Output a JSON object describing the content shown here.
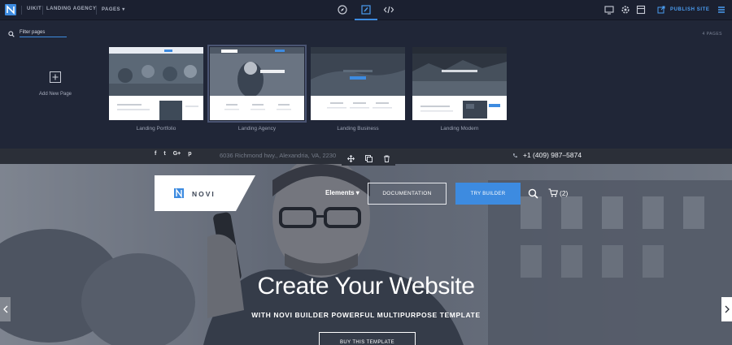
{
  "toolbar": {
    "app_name": "UIKIT",
    "project_name": "LANDING AGENCY",
    "pages_menu": "PAGES",
    "publish_label": "PUBLISH SITE",
    "icons": [
      "compass-icon",
      "edit-icon",
      "code-icon",
      "device-icon",
      "gear-icon",
      "archive-icon",
      "external-link-icon",
      "hamburger-icon"
    ]
  },
  "pages_panel": {
    "filter_label": "Filter pages",
    "pages_count": "4 PAGES",
    "add_page_label": "Add New Page",
    "pages": [
      {
        "label": "Landing Portfolio",
        "active": false
      },
      {
        "label": "Landing Agency",
        "active": true
      },
      {
        "label": "Landing Business",
        "active": false
      },
      {
        "label": "Landing Modern",
        "active": false
      }
    ]
  },
  "preview": {
    "social": [
      "f",
      "t",
      "G+",
      "p"
    ],
    "address": "6036 Richmond hwy., Alexandria, VA, 2230",
    "phone": "+1 (409) 987–5874",
    "nav": {
      "logo_text": "NOVI",
      "elements_menu": "Elements",
      "documentation_button": "DOCUMENTATION",
      "try_button": "TRY BUILDER",
      "cart_count": "(2)"
    },
    "hero": {
      "title": "Create Your Website",
      "subtitle": "WITH NOVI BUILDER POWERFUL MULTIPURPOSE TEMPLATE",
      "button": "BUY THIS TEMPLATE"
    }
  },
  "colors": {
    "accent": "#3d8be0",
    "toolbar_bg": "#1b2030",
    "panel_bg": "#202637"
  }
}
